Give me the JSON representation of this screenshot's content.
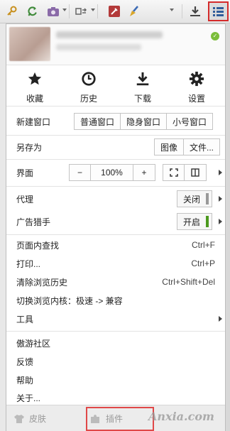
{
  "toolbar": {
    "icons": [
      "key-icon",
      "refresh-arrows-icon",
      "camera-icon",
      "proxy-icon",
      "tools-box-icon",
      "broom-icon",
      "more-caret-icon",
      "download-icon",
      "menu-list-icon"
    ]
  },
  "quick_actions": [
    {
      "label": "收藏",
      "icon": "star-icon"
    },
    {
      "label": "历史",
      "icon": "clock-icon"
    },
    {
      "label": "下载",
      "icon": "download-icon"
    },
    {
      "label": "设置",
      "icon": "gear-icon"
    }
  ],
  "new_window": {
    "label": "新建窗口",
    "options": [
      "普通窗口",
      "隐身窗口",
      "小号窗口"
    ]
  },
  "save_as": {
    "label": "另存为",
    "options": [
      "图像",
      "文件..."
    ]
  },
  "ui_zoom": {
    "label": "界面",
    "minus": "−",
    "value": "100%",
    "plus": "+"
  },
  "proxy": {
    "label": "代理",
    "toggle": "关闭"
  },
  "ad_hunter": {
    "label": "广告猎手",
    "toggle": "开启"
  },
  "menu_items": {
    "find": {
      "label": "页面内查找",
      "shortcut": "Ctrl+F"
    },
    "print": {
      "label": "打印...",
      "shortcut": "Ctrl+P"
    },
    "clear_history": {
      "label": "清除浏览历史",
      "shortcut": "Ctrl+Shift+Del"
    },
    "switch_core": {
      "label": "切换浏览内核：极速 -> 兼容"
    },
    "tools": {
      "label": "工具"
    },
    "community": {
      "label": "傲游社区"
    },
    "feedback": {
      "label": "反馈"
    },
    "help": {
      "label": "帮助"
    },
    "about": {
      "label": "关于..."
    }
  },
  "footer": {
    "skin": "皮肤",
    "plugins": "插件",
    "watermark": "Anxia.com"
  },
  "colors": {
    "highlight_red": "#d42b2b",
    "off_bar": "#999999",
    "on_bar": "#4c9a1e"
  }
}
